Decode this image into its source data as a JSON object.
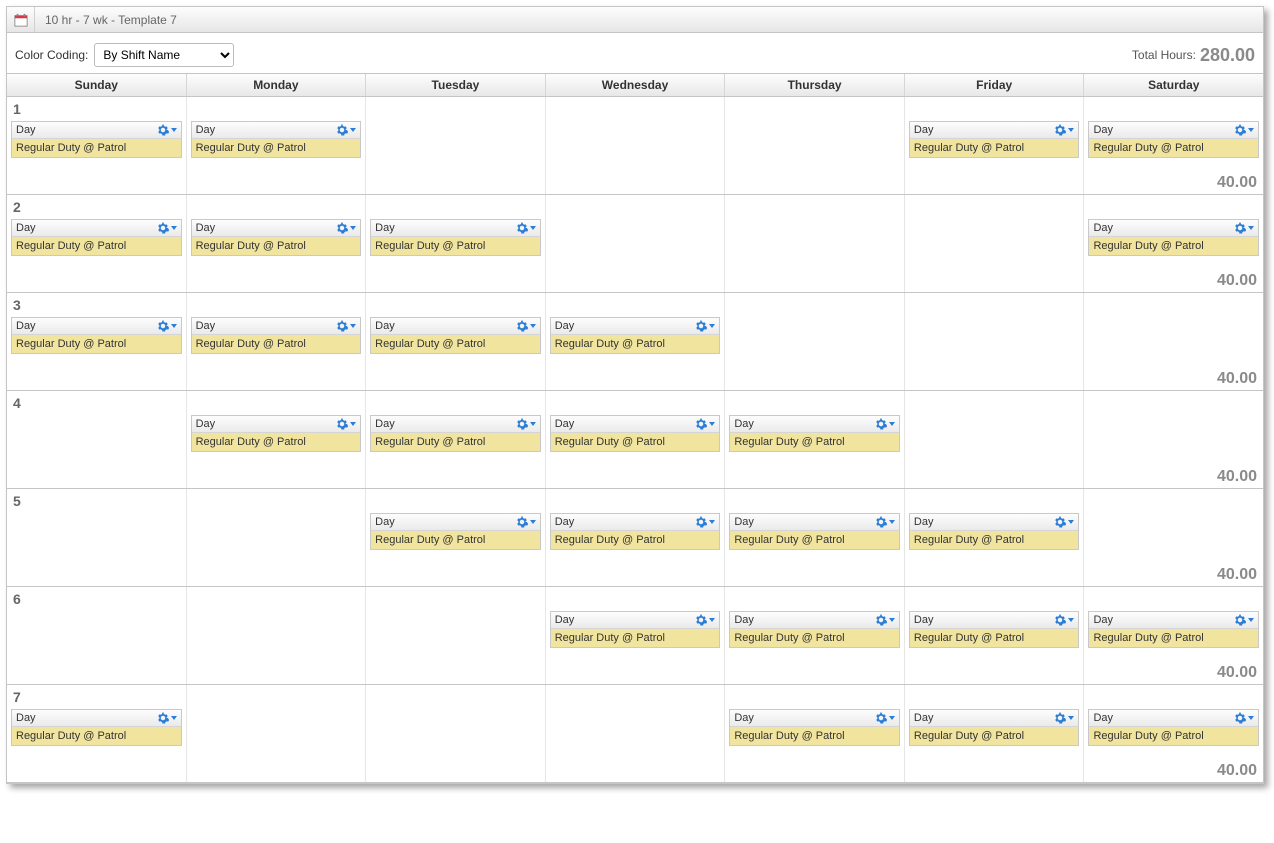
{
  "title": "10 hr - 7 wk - Template 7",
  "toolbar": {
    "color_coding_label": "Color Coding:",
    "color_coding_value": "By Shift Name",
    "total_label": "Total Hours:",
    "total_value": "280.00"
  },
  "days": [
    "Sunday",
    "Monday",
    "Tuesday",
    "Wednesday",
    "Thursday",
    "Friday",
    "Saturday"
  ],
  "shift": {
    "name": "Day",
    "detail": "Regular Duty @ Patrol"
  },
  "weeks": [
    {
      "num": "1",
      "total": "40.00",
      "cells": [
        true,
        true,
        false,
        false,
        false,
        true,
        true
      ]
    },
    {
      "num": "2",
      "total": "40.00",
      "cells": [
        true,
        true,
        true,
        false,
        false,
        false,
        true
      ]
    },
    {
      "num": "3",
      "total": "40.00",
      "cells": [
        true,
        true,
        true,
        true,
        false,
        false,
        false
      ]
    },
    {
      "num": "4",
      "total": "40.00",
      "cells": [
        false,
        true,
        true,
        true,
        true,
        false,
        false
      ]
    },
    {
      "num": "5",
      "total": "40.00",
      "cells": [
        false,
        false,
        true,
        true,
        true,
        true,
        false
      ]
    },
    {
      "num": "6",
      "total": "40.00",
      "cells": [
        false,
        false,
        false,
        true,
        true,
        true,
        true
      ]
    },
    {
      "num": "7",
      "total": "40.00",
      "cells": [
        true,
        false,
        false,
        false,
        true,
        true,
        true
      ]
    }
  ]
}
